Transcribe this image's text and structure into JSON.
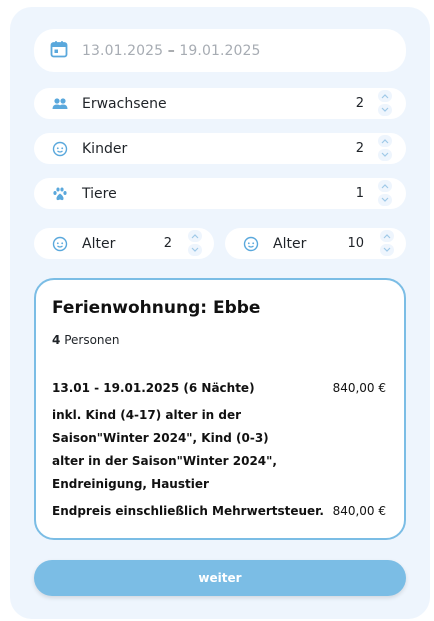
{
  "date_range": {
    "start": "13.01.2025",
    "separator": " – ",
    "end": "19.01.2025"
  },
  "guests": {
    "adults": {
      "label": "Erwachsene",
      "value": "2"
    },
    "children": {
      "label": "Kinder",
      "value": "2"
    },
    "pets": {
      "label": "Tiere",
      "value": "1"
    }
  },
  "child_ages": [
    {
      "label": "Alter",
      "value": "2"
    },
    {
      "label": "Alter",
      "value": "10"
    }
  ],
  "summary": {
    "title": "Ferienwohnung: Ebbe",
    "persons_count": "4",
    "persons_label": "Personen",
    "stay": "13.01 - 19.01.2025 (6 Nächte)",
    "stay_price": "840,00 €",
    "includes": "inkl. Kind (4-17) alter in der Saison\"Winter 2024\", Kind (0-3) alter in der Saison\"Winter 2024\", Endreinigung, Haustier",
    "total_label": "Endpreis einschließlich Mehrwertsteuer.",
    "total_price": "840,00 €"
  },
  "button": {
    "label": "weiter"
  },
  "icons": {
    "date": "calendar-icon",
    "adults": "people-icon",
    "children": "child-face-icon",
    "pets": "paw-icon",
    "age": "child-face-icon"
  },
  "colors": {
    "accent": "#7bbde5",
    "icon": "#5aa8dc",
    "panel": "#eef5fd"
  }
}
